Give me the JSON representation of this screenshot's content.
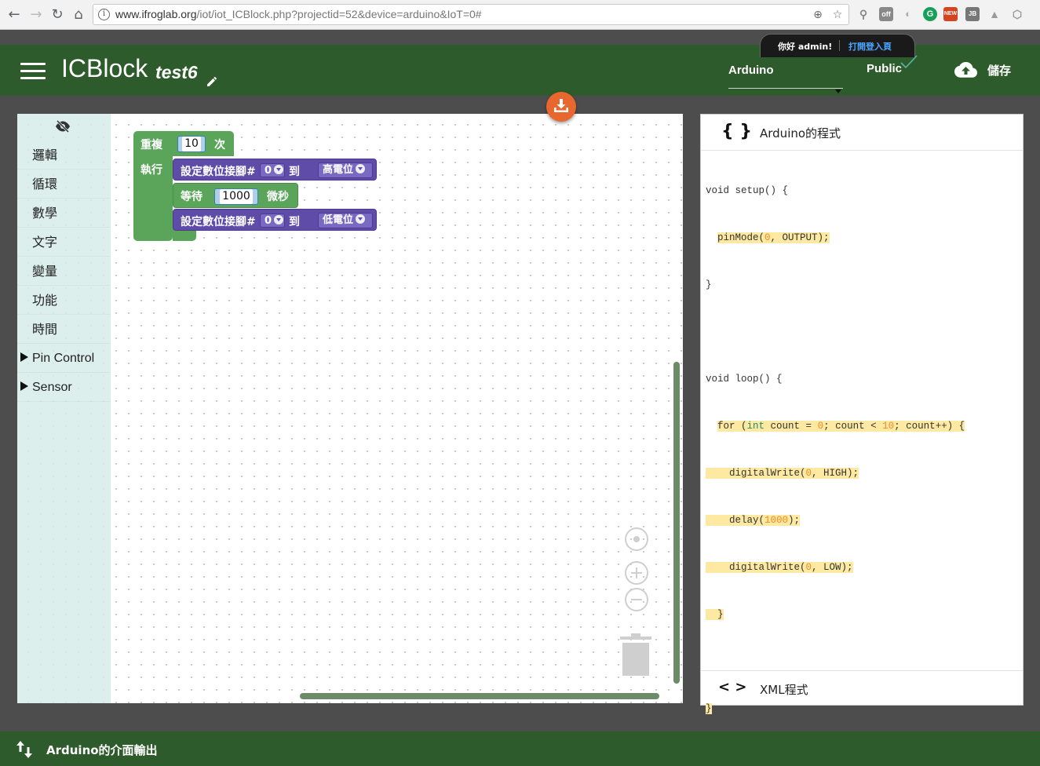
{
  "browser": {
    "url_host": "www.ifroglab.org",
    "url_path": "/iot/iot_ICBlock.php?projectid=52&device=arduino&IoT=0#"
  },
  "header": {
    "app_title": "ICBlock",
    "project_name": "test6",
    "device": "Arduino",
    "visibility": "Public",
    "save_label": "儲存"
  },
  "user": {
    "greeting": "你好 admin!",
    "login_link": "打開登入頁"
  },
  "toolbox": {
    "items": [
      "邏輯",
      "循環",
      "數學",
      "文字",
      "變量",
      "功能",
      "時間"
    ],
    "categories": [
      "Pin Control",
      "Sensor"
    ]
  },
  "blocks": {
    "repeat_label": "重複",
    "repeat_count": "10",
    "repeat_suffix": "次",
    "do_label": "執行",
    "set_pin_label": "設定數位接腳#",
    "pin_value_1": "0",
    "to_label": "到",
    "high_label": "高電位",
    "wait_label": "等待",
    "wait_value": "1000",
    "ms_label": "微秒",
    "pin_value_2": "0",
    "low_label": "低電位"
  },
  "code_panel": {
    "title": "Arduino的程式",
    "brace_icon": "{ }",
    "xml_title": "XML程式",
    "xml_icon": "< >"
  },
  "bottom_bar": {
    "label": "Arduino的介面輸出"
  },
  "colors": {
    "header_green": "#2e5b2b",
    "loop_green": "#5ba55b",
    "io_purple": "#5f4ca8",
    "download_orange": "#e8672e",
    "code_highlight": "#fde9a2"
  }
}
